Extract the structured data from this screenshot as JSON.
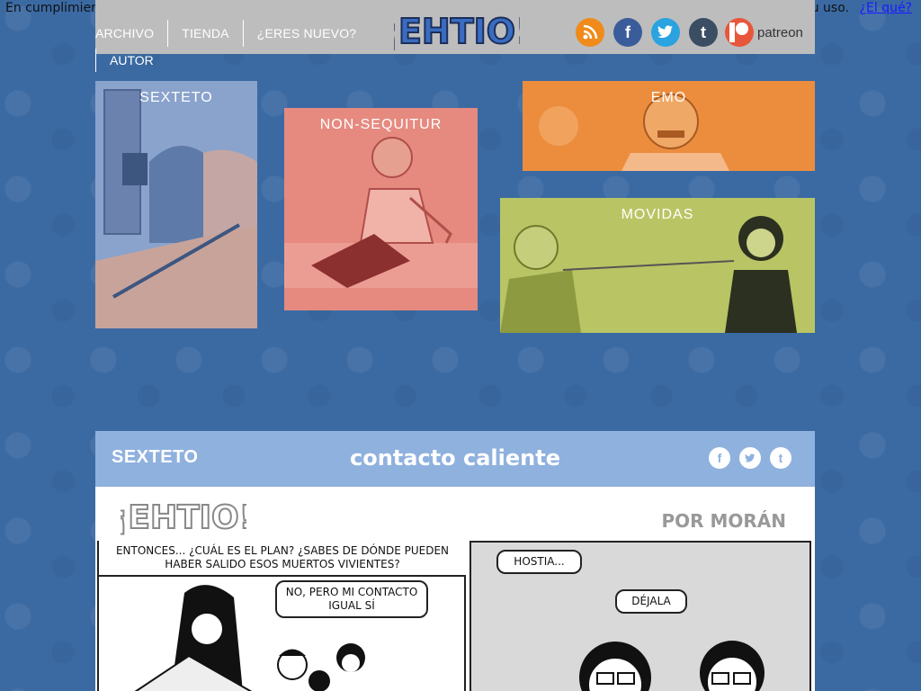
{
  "cookie": {
    "left_text": "En cumplimiento",
    "right_text": "su uso.",
    "link_text": "¿El qué?"
  },
  "nav": {
    "items": [
      {
        "label": "ARCHIVO"
      },
      {
        "label": "TIENDA"
      },
      {
        "label": "¿ERES NUEVO?"
      }
    ],
    "second_row": "AUTOR"
  },
  "logo": {
    "text": "¡EHTIO!"
  },
  "social": {
    "rss": "rss-icon",
    "facebook": "f",
    "twitter": "twitter-icon",
    "tumblr": "t",
    "patreon_label": "patreon"
  },
  "tiles": {
    "sexteto": "SEXTETO",
    "nonsequitur": "NON-SEQUITUR",
    "emo": "EMO",
    "movidas": "MOVIDAS"
  },
  "comic": {
    "series": "SEXTETO",
    "title": "contacto caliente",
    "share": {
      "facebook": "f",
      "twitter": "t",
      "tumblr": "t"
    },
    "logo_text": "¡EHTIO!",
    "author": "POR MORÁN",
    "panel1_caption": "ENTONCES... ¿CUÁL ES EL PLAN? ¿SABES DE DÓNDE PUEDEN HABER SALIDO ESOS MUERTOS VIVIENTES?",
    "panel1_bubble": "NO, PERO MI CONTACTO IGUAL SÍ",
    "panel2_bubble1": "HOSTIA...",
    "panel2_bubble2": "DÉJALA"
  },
  "colors": {
    "background": "#3b6aa3",
    "tile_sexteto": "#7e98c4",
    "tile_nonsequitur": "#e6837a",
    "tile_emo": "#ea8a3c",
    "tile_movidas": "#b8c35e"
  }
}
